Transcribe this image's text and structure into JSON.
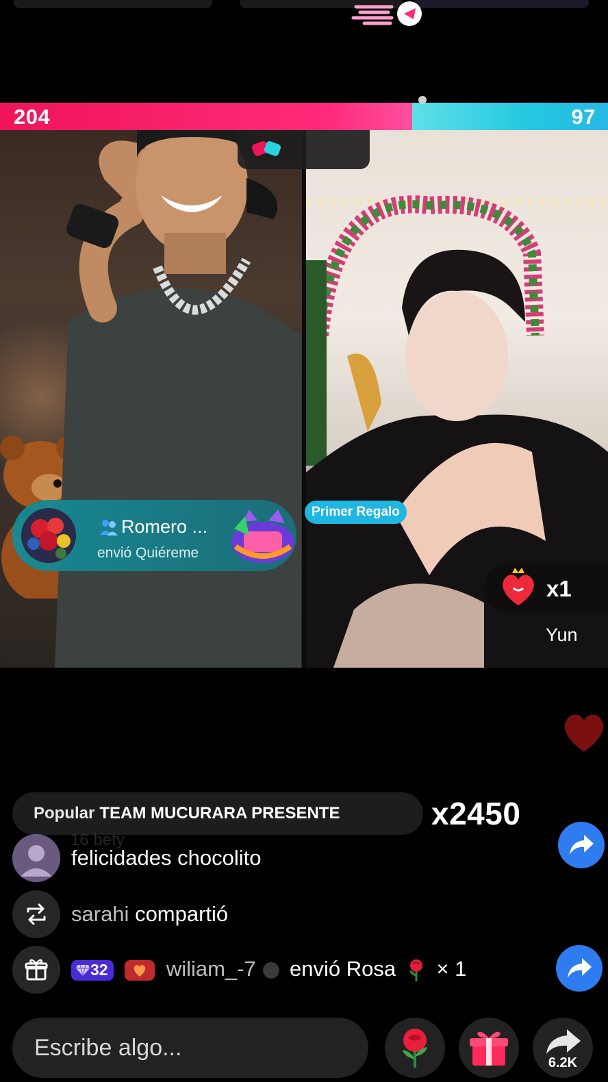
{
  "battle": {
    "left_score": "204",
    "right_score": "97",
    "left_share": 0.678,
    "left_color": "#f0145a",
    "right_color": "#27b9e6"
  },
  "gift_toast": {
    "username": "Romero ...",
    "action": "envió Quiéreme"
  },
  "first_gift_tag": "Primer Regalo",
  "combo": {
    "count": "x1",
    "name": "Yun"
  },
  "popular": {
    "label": "Popular",
    "team": "TEAM MUCURARA PRESENTE",
    "multiplier": "x2450"
  },
  "chat": {
    "ghost": "16   bety",
    "messages": [
      {
        "text": "felicidades chocolito"
      },
      {
        "user": "sarahi",
        "text": "compartió"
      },
      {
        "level": "32",
        "user": "wiliam_-7",
        "text": "envió Rosa",
        "gift_icon": "rose-icon",
        "qty": "× 1"
      }
    ]
  },
  "input": {
    "placeholder": "Escribe algo..."
  },
  "actions": {
    "share_count": "6.2K"
  },
  "colors": {
    "share_blue": "#2f7bf0",
    "heart_red": "#7a1010",
    "toast_teal": "#148c96"
  }
}
